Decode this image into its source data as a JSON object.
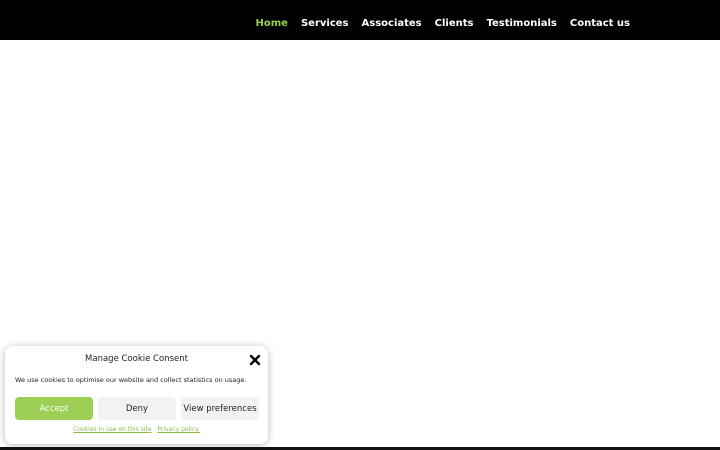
{
  "nav": {
    "items": [
      {
        "label": "Home",
        "active": true
      },
      {
        "label": "Services"
      },
      {
        "label": "Associates"
      },
      {
        "label": "Clients"
      },
      {
        "label": "Testimonials"
      },
      {
        "label": "Contact us"
      }
    ],
    "active_color": "#9dcf54",
    "bar_color": "#000000"
  },
  "cookie_banner": {
    "title": "Manage Cookie Consent",
    "close_icon": "close-icon",
    "message": "We use cookies to optimise our website and collect statistics on usage.",
    "accept_label": "Accept",
    "deny_label": "Deny",
    "preferences_label": "View preferences",
    "links": {
      "cookies_label": "Cookies in use on this site",
      "privacy_label": "Privacy policy."
    },
    "accent_color": "#9dcf54"
  }
}
